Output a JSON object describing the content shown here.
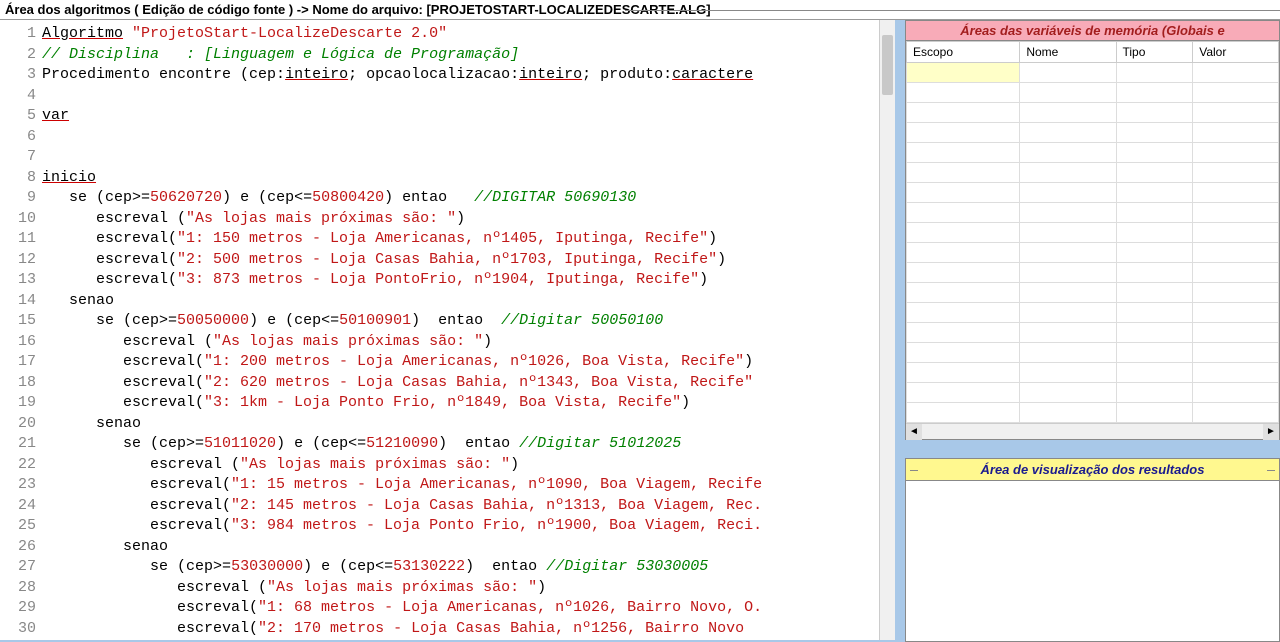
{
  "titleBar": {
    "prefix": "Área dos algoritmos ( Edição de código fonte ) -> Nome do arquivo: ",
    "filename": "[PROJETOSTART-LOCALIZEDESCARTE.ALG]"
  },
  "code": {
    "firstLine": 1,
    "lines": [
      {
        "n": 1,
        "seg": [
          [
            "kw",
            "Algoritmo"
          ],
          [
            "",
            ""
          ],
          [
            "",
            " "
          ],
          [
            "str",
            "\"ProjetoStart-LocalizeDescarte 2.0\""
          ]
        ]
      },
      {
        "n": 2,
        "seg": [
          [
            "cmt",
            "// Disciplina   : [Linguagem e Lógica de Programação]"
          ]
        ]
      },
      {
        "n": 3,
        "seg": [
          [
            "kw2",
            "Procedimento"
          ],
          [
            "",
            " encontre (cep:"
          ],
          [
            "type",
            "inteiro"
          ],
          [
            "",
            "; opcaolocalizacao:"
          ],
          [
            "type",
            "inteiro"
          ],
          [
            "",
            "; produto:"
          ],
          [
            "type",
            "caractere"
          ]
        ]
      },
      {
        "n": 4,
        "seg": [
          [
            "",
            ""
          ]
        ]
      },
      {
        "n": 5,
        "seg": [
          [
            "kw",
            "var"
          ]
        ]
      },
      {
        "n": 6,
        "seg": [
          [
            "",
            ""
          ]
        ]
      },
      {
        "n": 7,
        "seg": [
          [
            "",
            ""
          ]
        ]
      },
      {
        "n": 8,
        "seg": [
          [
            "kw",
            "inicio"
          ]
        ]
      },
      {
        "n": 9,
        "seg": [
          [
            "",
            "   "
          ],
          [
            "kw2",
            "se"
          ],
          [
            "",
            " (cep>="
          ],
          [
            "num",
            "50620720"
          ],
          [
            "",
            ") "
          ],
          [
            "kw2",
            "e"
          ],
          [
            "",
            " (cep<="
          ],
          [
            "num",
            "50800420"
          ],
          [
            "",
            ") "
          ],
          [
            "kw2",
            "entao"
          ],
          [
            "",
            "   "
          ],
          [
            "cmt",
            "//DIGITAR 50690130"
          ]
        ]
      },
      {
        "n": 10,
        "seg": [
          [
            "",
            "      escreval ("
          ],
          [
            "str",
            "\"As lojas mais próximas são: \""
          ],
          [
            "",
            ")"
          ]
        ]
      },
      {
        "n": 11,
        "seg": [
          [
            "",
            "      escreval("
          ],
          [
            "str",
            "\"1: 150 metros - Loja Americanas, nº1405, Iputinga, Recife\""
          ],
          [
            "",
            ")"
          ]
        ]
      },
      {
        "n": 12,
        "seg": [
          [
            "",
            "      escreval("
          ],
          [
            "str",
            "\"2: 500 metros - Loja Casas Bahia, nº1703, Iputinga, Recife\""
          ],
          [
            "",
            ")"
          ]
        ]
      },
      {
        "n": 13,
        "seg": [
          [
            "",
            "      escreval("
          ],
          [
            "str",
            "\"3: 873 metros - Loja PontoFrio, nº1904, Iputinga, Recife\""
          ],
          [
            "",
            ")"
          ]
        ]
      },
      {
        "n": 14,
        "seg": [
          [
            "",
            "   "
          ],
          [
            "kw2",
            "senao"
          ]
        ]
      },
      {
        "n": 15,
        "seg": [
          [
            "",
            "      "
          ],
          [
            "kw2",
            "se"
          ],
          [
            "",
            " (cep>="
          ],
          [
            "num",
            "50050000"
          ],
          [
            "",
            ") "
          ],
          [
            "kw2",
            "e"
          ],
          [
            "",
            " (cep<="
          ],
          [
            "num",
            "50100901"
          ],
          [
            "",
            ")  "
          ],
          [
            "kw2",
            "entao"
          ],
          [
            "",
            "  "
          ],
          [
            "cmt",
            "//Digitar 50050100"
          ]
        ]
      },
      {
        "n": 16,
        "seg": [
          [
            "",
            "         escreval ("
          ],
          [
            "str",
            "\"As lojas mais próximas são: \""
          ],
          [
            "",
            ")"
          ]
        ]
      },
      {
        "n": 17,
        "seg": [
          [
            "",
            "         escreval("
          ],
          [
            "str",
            "\"1: 200 metros - Loja Americanas, nº1026, Boa Vista, Recife\""
          ],
          [
            "",
            ")"
          ]
        ]
      },
      {
        "n": 18,
        "seg": [
          [
            "",
            "         escreval("
          ],
          [
            "str",
            "\"2: 620 metros - Loja Casas Bahia, nº1343, Boa Vista, Recife\""
          ]
        ]
      },
      {
        "n": 19,
        "seg": [
          [
            "",
            "         escreval("
          ],
          [
            "str",
            "\"3: 1km - Loja Ponto Frio, nº1849, Boa Vista, Recife\""
          ],
          [
            "",
            ")"
          ]
        ]
      },
      {
        "n": 20,
        "seg": [
          [
            "",
            "      "
          ],
          [
            "kw2",
            "senao"
          ]
        ]
      },
      {
        "n": 21,
        "seg": [
          [
            "",
            "         "
          ],
          [
            "kw2",
            "se"
          ],
          [
            "",
            " (cep>="
          ],
          [
            "num",
            "51011020"
          ],
          [
            "",
            ") "
          ],
          [
            "kw2",
            "e"
          ],
          [
            "",
            " (cep<="
          ],
          [
            "num",
            "51210090"
          ],
          [
            "",
            ")  "
          ],
          [
            "kw2",
            "entao"
          ],
          [
            "",
            " "
          ],
          [
            "cmt",
            "//Digitar 51012025"
          ]
        ]
      },
      {
        "n": 22,
        "seg": [
          [
            "",
            "            escreval ("
          ],
          [
            "str",
            "\"As lojas mais próximas são: \""
          ],
          [
            "",
            ")"
          ]
        ]
      },
      {
        "n": 23,
        "seg": [
          [
            "",
            "            escreval("
          ],
          [
            "str",
            "\"1: 15 metros - Loja Americanas, nº1090, Boa Viagem, Recife"
          ]
        ]
      },
      {
        "n": 24,
        "seg": [
          [
            "",
            "            escreval("
          ],
          [
            "str",
            "\"2: 145 metros - Loja Casas Bahia, nº1313, Boa Viagem, Rec."
          ]
        ]
      },
      {
        "n": 25,
        "seg": [
          [
            "",
            "            escreval("
          ],
          [
            "str",
            "\"3: 984 metros - Loja Ponto Frio, nº1900, Boa Viagem, Reci."
          ]
        ]
      },
      {
        "n": 26,
        "seg": [
          [
            "",
            "         "
          ],
          [
            "kw2",
            "senao"
          ]
        ]
      },
      {
        "n": 27,
        "seg": [
          [
            "",
            "            "
          ],
          [
            "kw2",
            "se"
          ],
          [
            "",
            " (cep>="
          ],
          [
            "num",
            "53030000"
          ],
          [
            "",
            ") "
          ],
          [
            "kw2",
            "e"
          ],
          [
            "",
            " (cep<="
          ],
          [
            "num",
            "53130222"
          ],
          [
            "",
            ")  "
          ],
          [
            "kw2",
            "entao"
          ],
          [
            "",
            " "
          ],
          [
            "cmt",
            "//Digitar 53030005"
          ]
        ]
      },
      {
        "n": 28,
        "seg": [
          [
            "",
            "               escreval ("
          ],
          [
            "str",
            "\"As lojas mais próximas são: \""
          ],
          [
            "",
            ")"
          ]
        ]
      },
      {
        "n": 29,
        "seg": [
          [
            "",
            "               escreval("
          ],
          [
            "str",
            "\"1: 68 metros - Loja Americanas, nº1026, Bairro Novo, O."
          ]
        ]
      },
      {
        "n": 30,
        "seg": [
          [
            "",
            "               escreval("
          ],
          [
            "str",
            "\"2: 170 metros - Loja Casas Bahia, nº1256, Bairro Novo"
          ]
        ]
      }
    ]
  },
  "varPanel": {
    "title": "Áreas das variáveis de memória (Globais e",
    "columns": [
      "Escopo",
      "Nome",
      "Tipo",
      "Valor"
    ],
    "rowCount": 18
  },
  "resultsPanel": {
    "title": "Área de visualização dos resultados"
  }
}
